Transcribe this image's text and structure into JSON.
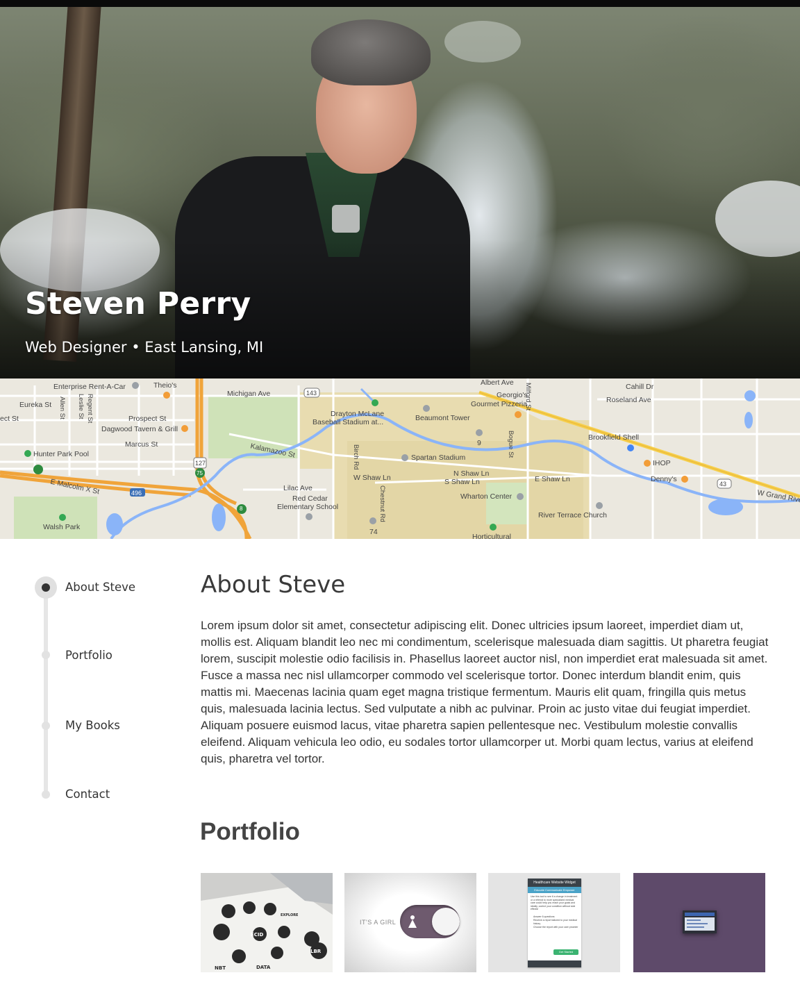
{
  "hero": {
    "name": "Steven Perry",
    "subtitle": "Web Designer • East Lansing, MI"
  },
  "map": {
    "labels": [
      "Enterprise Rent-A-Car",
      "Theio's",
      "Michigan Ave",
      "143",
      "Albert Ave",
      "Georgio's",
      "Gourmet Pizzeria",
      "Milford St",
      "Cahill Dr",
      "Roseland Ave",
      "Eureka St",
      "Allen St",
      "Regent St",
      "Leslie St",
      "ect St",
      "Prospect St",
      "Dagwood Tavern & Grill",
      "Marcus St",
      "Drayton McLane",
      "Baseball Stadium at...",
      "Beaumont Tower",
      "Brookfield Shell",
      "Hunter Park Pool",
      "Kalamazoo St",
      "127",
      "Spartan Stadium",
      "Birch Rd",
      "Bogue St",
      "IHOP",
      "Denny's",
      "43",
      "W Grand Rive",
      "E Malcolm X St",
      "496",
      "W Shaw Ln",
      "N Shaw Ln",
      "S Shaw Ln",
      "E Shaw Ln",
      "Lilac Ave",
      "Red Cedar",
      "Elementary School",
      "Chestnut Rd",
      "Wharton Center",
      "River Terrace Church",
      "Walsh Park",
      "74",
      "Horticultural",
      "75",
      "8",
      "9"
    ]
  },
  "nav": {
    "items": [
      "About Steve",
      "Portfolio",
      "My Books",
      "Contact"
    ]
  },
  "about": {
    "title": "About Steve",
    "body": "Lorem ipsum dolor sit amet, consectetur adipiscing elit. Donec ultricies ipsum laoreet, imperdiet diam ut, mollis est. Aliquam blandit leo nec mi condimentum, scelerisque malesuada diam sagittis. Ut pharetra feugiat lorem, suscipit molestie odio facilisis in. Phasellus laoreet auctor nisl, non imperdiet erat malesuada sit amet. Fusce a massa nec nisl ullamcorper commodo vel scelerisque tortor. Donec interdum blandit enim, quis mattis mi. Maecenas lacinia quam eget magna tristique fermentum. Mauris elit quam, fringilla quis metus quis, malesuada lacinia lectus. Sed vulputate a nibh ac pulvinar. Proin ac justo vitae dui feugiat imperdiet. Aliquam posuere euismod lacus, vitae pharetra sapien pellentesque nec. Vestibulum molestie convallis eleifend. Aliquam vehicula leo odio, eu sodales tortor ullamcorper ut. Morbi quam lectus, varius at eleifend quis, pharetra vel tortor."
  },
  "portfolio": {
    "title": "Portfolio",
    "thumb1": {
      "labels": [
        "NBT",
        "LBR",
        "ECID",
        "DATA",
        "EXPLORE"
      ]
    },
    "thumb2": {
      "text": "IT'S A GIRL"
    },
    "thumb3": {
      "header": "Healthcare Website Widget",
      "tabs": "Educate  Communicate  Empower",
      "body": "Use this tool to see if a change in treatment or a referral to more specialized medical care could help you reach your goals and ideally, control your condition without side effects!",
      "bullets": [
        "Answer 6 questions",
        "Receive a report tailored to your medical history",
        "Choose the report with your care provider"
      ],
      "button": "Get Started"
    },
    "thumb4": {},
    "colors": {
      "purple": "#5e4a6a",
      "toggle": "#6e5a6e"
    }
  }
}
